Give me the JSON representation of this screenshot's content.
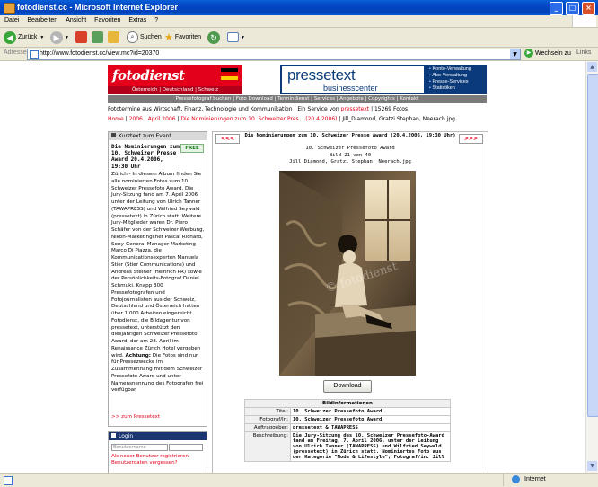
{
  "window": {
    "title": "fotodienst.cc - Microsoft Internet Explorer"
  },
  "menu": [
    "Datei",
    "Bearbeiten",
    "Ansicht",
    "Favoriten",
    "Extras",
    "?"
  ],
  "toolbar": {
    "back": "Zurück",
    "search": "Suchen",
    "favorites": "Favoriten"
  },
  "address": {
    "label": "Adresse",
    "url": "http://www.fotodienst.cc/view.mc?id=20370",
    "go": "Wechseln zu",
    "links": "Links"
  },
  "site": {
    "logo": "fotodienst",
    "region": "Österreich | Deutschland | Schweiz",
    "pt_logo": "pressetext",
    "pt_sub": "businesscenter",
    "pt_menu": [
      "Konto-Verwaltung",
      "Abo-Verwaltung",
      "Presse-Services",
      "Statistiken"
    ],
    "nav": "Pressefotograf buchen | Foto Download | Termindienst | Services | Angebote | Copyrights | Kontakt",
    "tagline_pre": "Fototermine aus Wirtschaft, Finanz, Technologie und Kommunikation | Ein Service von ",
    "tagline_link": "pressetext",
    "tagline_post": " | 15269 Fotos",
    "crumbs": {
      "c1": "Home",
      "c2": "2006",
      "c3": "April 2006",
      "c4": "Die Nominierungen zum 10. Schweizer Pres... (20.4.2006)",
      "c5": "Jill_Diamond, Gratzi Stephan, Neerach.jpg",
      "sep": " | "
    }
  },
  "left": {
    "header": "Kurztext zum Event",
    "title": "Die Nominierungen zum 10. Schweizer Presse Award 20.4.2006, 19:30 Uhr",
    "free": "FREE",
    "body_pre": "Zürich - In diesem Album finden Sie alle nominierten Fotos zum 10. Schweizer Pressefoto Award. Die Jury-Sitzung fand am 7. April 2006 unter der Leitung von Ulrich Tanner (TAWAPRESS) und Wilfried Seywald (pressetext) in Zürich statt. Weitere Jury-Mitglieder waren Dr. Piero Schäfer von der Schweizer Werbung, Nikon-Marketingchef Pascal Richard, Sony-General Manager Marketing Marco Di Piazza, die Kommunikationsexperten Manuela Stier (Stier Communications) und Andreas Steiner (Heinrich PR) sowie der Persönlichkeits-Fotograf Daniel Schmuki. Knapp 300 Pressefotografen und Fotojournalisten aus der Schweiz, Deutschland und Österreich hatten über 1.000 Arbeiten eingereicht. Fotodienst, die Bildagentur von pressetext, unterstützt den diesjährigen Schweizer Pressefoto Award, der am 28. April im Renaissance Zürich Hotel vergeben wird.",
    "attn_label": "Achtung:",
    "attn_text": " Die Fotos sind nur für Pressezwecke im Zusammenhang mit dem Schweizer Pressefoto Award und unter Namensnennung des Fotografen frei verfügbar.",
    "more": ">> zum Pressetext"
  },
  "login": {
    "header": "Login",
    "user_placeholder": "Benutzername",
    "link1": "Als neuer Benutzer registrieren",
    "link2": "Benutzerdaten vergessen?"
  },
  "photo_panel": {
    "prev": "<<<",
    "next": ">>>",
    "title": "Die Nominierungen zum 10. Schweizer Presse Award (20.4.2006, 19:30 Uhr)",
    "album": "10. Schweizer Pressefoto Award",
    "counter": "Bild 21 von 40",
    "filename": "Jill_Diamond, Gratzi Stephan, Neerach.jpg",
    "watermark": "© fotodienst",
    "download": "Download"
  },
  "info": {
    "header": "Bildinformationen",
    "rows": [
      {
        "k": "Titel:",
        "v": "10. Schweizer Pressefoto Award"
      },
      {
        "k": "Fotograf/In:",
        "v": "10. Schweizer Pressefoto Award"
      },
      {
        "k": "Auftraggeber:",
        "v": "pressetext & TAWAPRESS"
      },
      {
        "k": "Beschreibung:",
        "v": "Die Jury-Sitzung des 10. Schweizer Pressefoto-Award fand am Freitag, 7. April 2006, unter der Leitung von Ulrich Tanner (TAWAPRESS) und Wilfried Seywald (pressetext) in Zürich statt. Nominiertes Foto aus der Kategorie \"Mode & Lifestyle\"; Fotograf/in: Jill"
      }
    ]
  },
  "status": {
    "zone": "Internet"
  },
  "colors": {
    "brand_red": "#E2001A",
    "pt_blue": "#0A3A7A",
    "xp_blue": "#0043B9"
  }
}
